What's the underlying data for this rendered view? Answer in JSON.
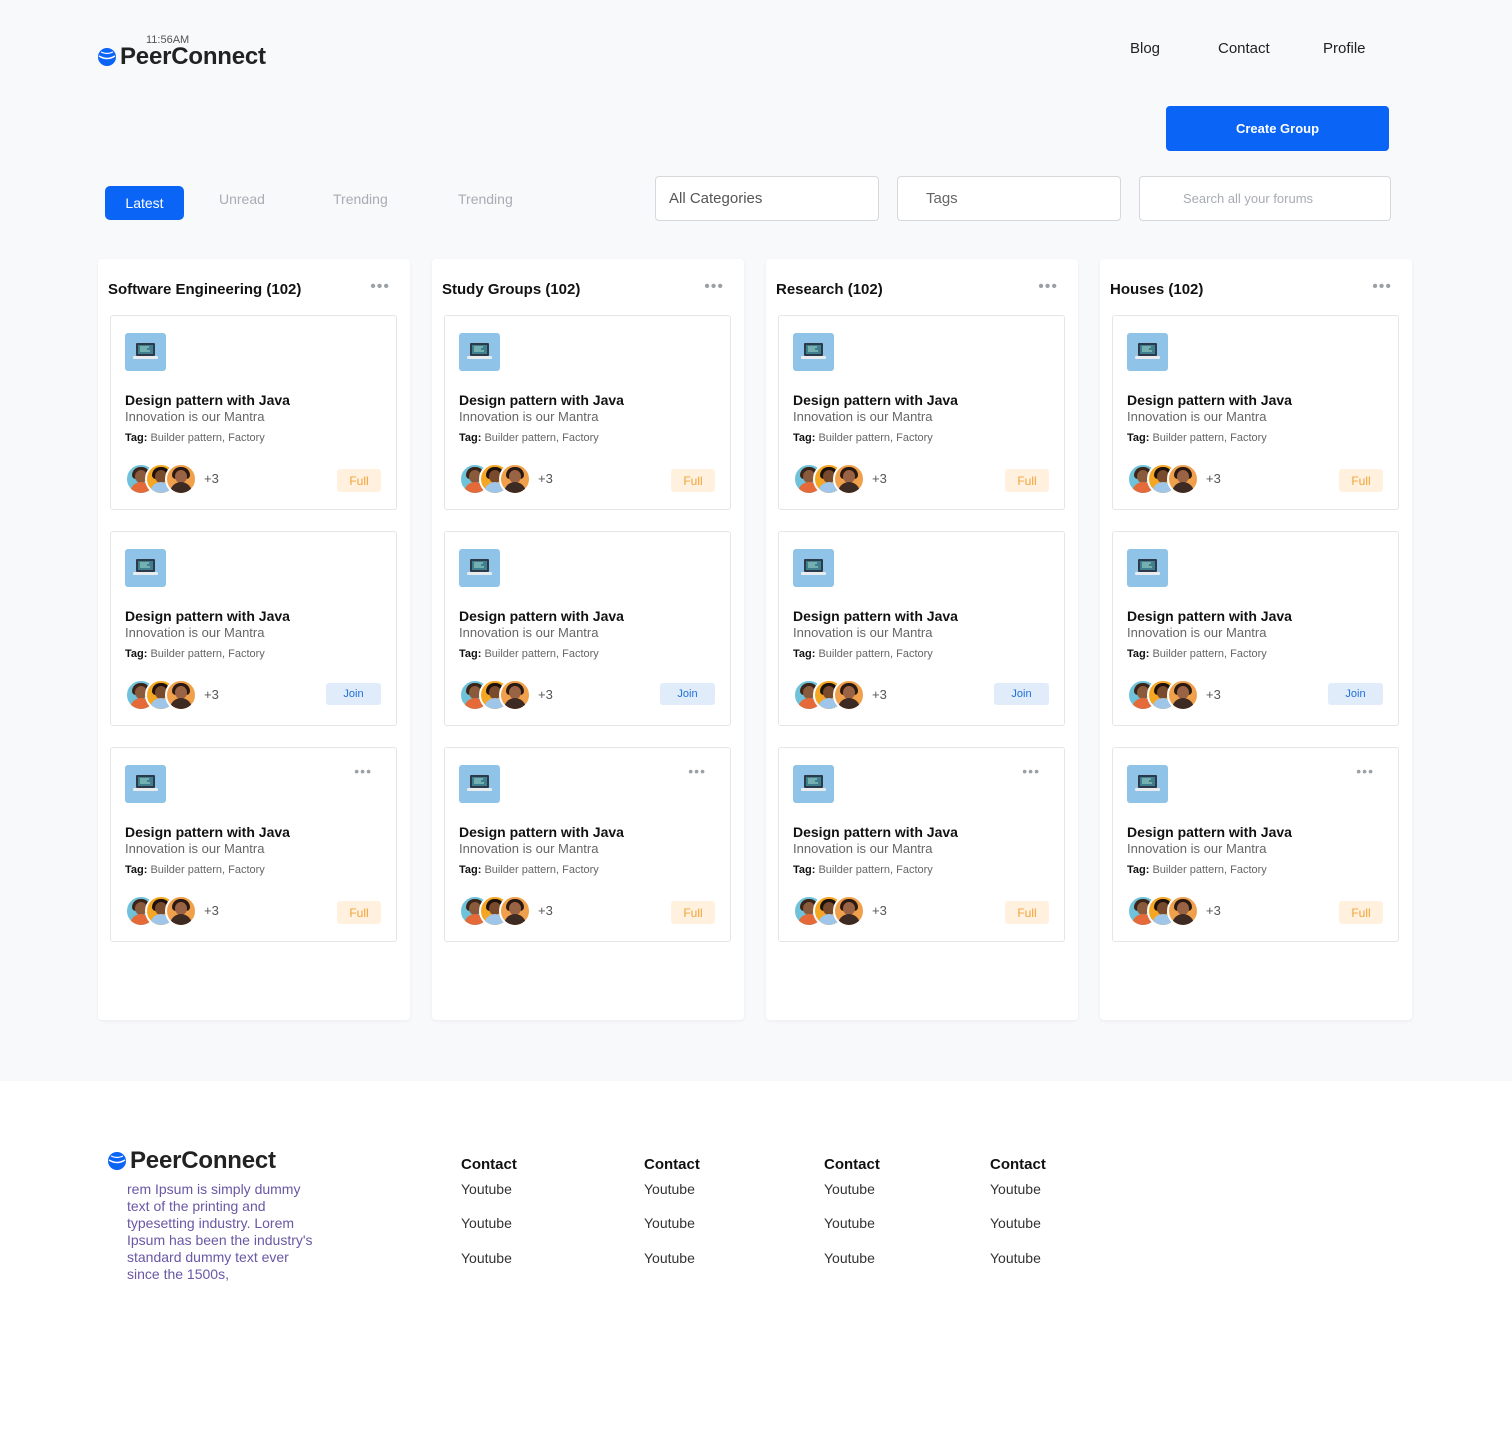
{
  "brand": {
    "time": "11:56AM",
    "name": "PeerConnect",
    "accent": "#0a64f5"
  },
  "nav": {
    "links": [
      "Blog",
      "Contact",
      "Profile"
    ]
  },
  "actions": {
    "create_group": "Create Group"
  },
  "filters": {
    "tabs": [
      "Latest",
      "Unread",
      "Trending",
      "Trending"
    ],
    "active_tab": "Latest",
    "categories_value": "All Categories",
    "tags_placeholder": "Tags",
    "search_placeholder": "Search all your forums"
  },
  "columns": [
    {
      "title": "Software Engineering (102)",
      "cards": [
        {
          "title": "Design pattern with Java",
          "subtitle": "Innovation is our Mantra",
          "tag_label": "Tag:",
          "tags": "Builder pattern, Factory",
          "more_count": "+3",
          "status": "Full",
          "has_menu": false
        },
        {
          "title": "Design pattern with Java",
          "subtitle": "Innovation is our Mantra",
          "tag_label": "Tag:",
          "tags": "Builder pattern, Factory",
          "more_count": "+3",
          "status": "Join",
          "has_menu": false
        },
        {
          "title": "Design pattern with Java",
          "subtitle": "Innovation is our Mantra",
          "tag_label": "Tag:",
          "tags": "Builder pattern, Factory",
          "more_count": "+3",
          "status": "Full",
          "has_menu": true
        }
      ]
    },
    {
      "title": "Study Groups (102)",
      "cards": [
        {
          "title": "Design pattern with Java",
          "subtitle": "Innovation is our Mantra",
          "tag_label": "Tag:",
          "tags": "Builder pattern, Factory",
          "more_count": "+3",
          "status": "Full",
          "has_menu": false
        },
        {
          "title": "Design pattern with Java",
          "subtitle": "Innovation is our Mantra",
          "tag_label": "Tag:",
          "tags": "Builder pattern, Factory",
          "more_count": "+3",
          "status": "Join",
          "has_menu": false
        },
        {
          "title": "Design pattern with Java",
          "subtitle": "Innovation is our Mantra",
          "tag_label": "Tag:",
          "tags": "Builder pattern, Factory",
          "more_count": "+3",
          "status": "Full",
          "has_menu": true
        }
      ]
    },
    {
      "title": "Research (102)",
      "cards": [
        {
          "title": "Design pattern with Java",
          "subtitle": "Innovation is our Mantra",
          "tag_label": "Tag:",
          "tags": "Builder pattern, Factory",
          "more_count": "+3",
          "status": "Full",
          "has_menu": false
        },
        {
          "title": "Design pattern with Java",
          "subtitle": "Innovation is our Mantra",
          "tag_label": "Tag:",
          "tags": "Builder pattern, Factory",
          "more_count": "+3",
          "status": "Join",
          "has_menu": false
        },
        {
          "title": "Design pattern with Java",
          "subtitle": "Innovation is our Mantra",
          "tag_label": "Tag:",
          "tags": "Builder pattern, Factory",
          "more_count": "+3",
          "status": "Full",
          "has_menu": true
        }
      ]
    },
    {
      "title": "Houses (102)",
      "cards": [
        {
          "title": "Design pattern with Java",
          "subtitle": "Innovation is our Mantra",
          "tag_label": "Tag:",
          "tags": "Builder pattern, Factory",
          "more_count": "+3",
          "status": "Full",
          "has_menu": false
        },
        {
          "title": "Design pattern with Java",
          "subtitle": "Innovation is our Mantra",
          "tag_label": "Tag:",
          "tags": "Builder pattern, Factory",
          "more_count": "+3",
          "status": "Join",
          "has_menu": false
        },
        {
          "title": "Design pattern with Java",
          "subtitle": "Innovation is our Mantra",
          "tag_label": "Tag:",
          "tags": "Builder pattern, Factory",
          "more_count": "+3",
          "status": "Full",
          "has_menu": true
        }
      ]
    }
  ],
  "footer": {
    "brand": "PeerConnect",
    "description": "rem Ipsum is simply dummy text of the printing and typesetting industry. Lorem Ipsum has been the industry's standard dummy text ever since the 1500s,",
    "columns": [
      {
        "heading": "Contact",
        "links": [
          "Youtube",
          "Youtube",
          "Youtube"
        ]
      },
      {
        "heading": "Contact",
        "links": [
          "Youtube",
          "Youtube",
          "Youtube"
        ]
      },
      {
        "heading": "Contact",
        "links": [
          "Youtube",
          "Youtube",
          "Youtube"
        ]
      },
      {
        "heading": "Contact",
        "links": [
          "Youtube",
          "Youtube",
          "Youtube"
        ]
      }
    ]
  },
  "colors": {
    "full_badge_bg": "#fff1de",
    "full_badge_text": "#f2a33a",
    "join_badge_bg": "#e1ecfb",
    "join_badge_text": "#1e6fd9"
  }
}
